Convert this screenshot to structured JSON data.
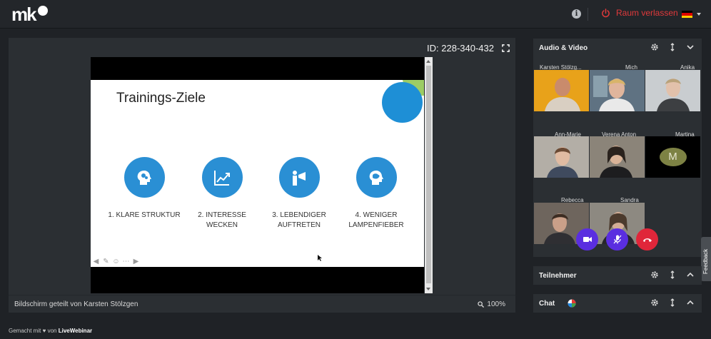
{
  "header": {
    "logo_text": "mk",
    "info_glyph": "i",
    "leave_label": "Raum verlassen",
    "language_flag": "de",
    "colors": {
      "leave": "#e0393b"
    }
  },
  "stage": {
    "session_id": "ID: 228-340-432",
    "slide": {
      "title": "Trainings-Ziele",
      "goals": [
        {
          "line1": "1. KLARE STRUKTUR",
          "line2": "",
          "icon": "head-gears-icon"
        },
        {
          "line1": "2. INTERESSE",
          "line2": "WECKEN",
          "icon": "chart-up-icon"
        },
        {
          "line1": "3. LEBENDIGER",
          "line2": "AUFTRETEN",
          "icon": "megaphone-person-icon"
        },
        {
          "line1": "4. WENIGER",
          "line2": "LAMPENFIEBER",
          "icon": "brain-head-icon"
        }
      ],
      "accent": "#2a8fd4"
    },
    "shared_by": "Bildschirm geteilt von Karsten Stölzgen",
    "zoom": "100%"
  },
  "footer": {
    "prefix": "Gemacht mit",
    "heart": "♥",
    "middle": "von",
    "brand": "LiveWebinar"
  },
  "audio_video": {
    "title": "Audio & Video",
    "participants": [
      {
        "name": "Karsten Stölzg...",
        "bg": "#e8a21a"
      },
      {
        "name": "Mich",
        "bg": "#7a8fa0"
      },
      {
        "name": "Anika",
        "bg": "#cfd3d6"
      },
      {
        "name": "Ann-Marie",
        "bg": "#b7b3ad"
      },
      {
        "name": "Verena Anton",
        "bg": "#8a8377"
      },
      {
        "name": "Martina",
        "bg": "#000000",
        "initial": "M"
      },
      {
        "name": "Rebecca",
        "bg": "#6b625b"
      },
      {
        "name": "Sandra",
        "bg": "#8c8880"
      }
    ],
    "controls": {
      "camera": "#5a2ee0",
      "mic_off": "#5a2ee0",
      "hangup": "#e0263a"
    }
  },
  "teilnehmer": {
    "title": "Teilnehmer"
  },
  "chat": {
    "title": "Chat"
  },
  "feedback_label": "Feedback"
}
